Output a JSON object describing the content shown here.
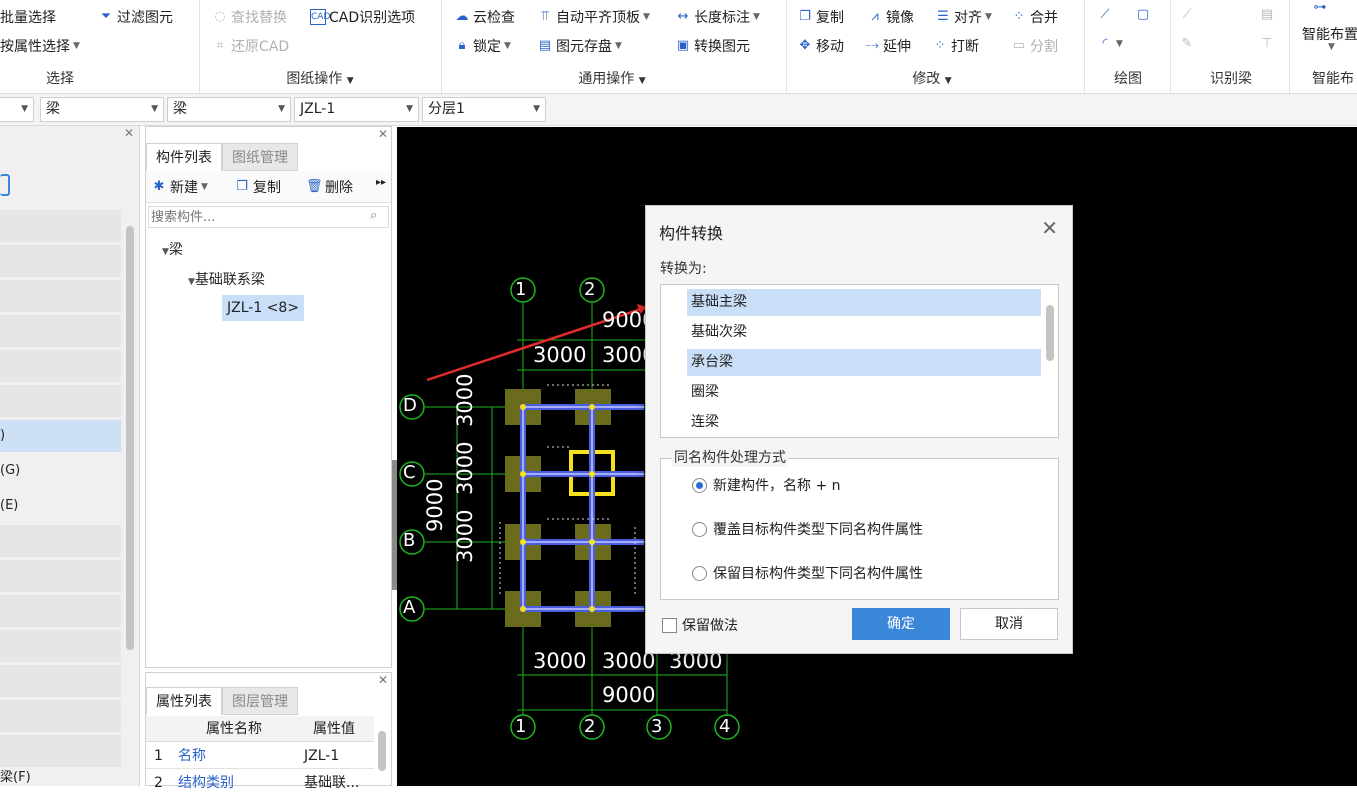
{
  "ribbon": {
    "select": {
      "batch": "批量选择",
      "filter": "过滤图元",
      "by_attr": "按属性选择",
      "label": "选择"
    },
    "drawing_ops": {
      "find_replace": "查找替换",
      "cad_options": "CAD识别选项",
      "restore_cad": "还原CAD",
      "label": "图纸操作"
    },
    "general_ops": {
      "cloud_check": "云检查",
      "auto_align": "自动平齐顶板",
      "length_dim": "长度标注",
      "lock": "锁定",
      "save_elements": "图元存盘",
      "convert": "转换图元",
      "label": "通用操作"
    },
    "modify": {
      "copy": "复制",
      "mirror": "镜像",
      "align": "对齐",
      "merge": "合并",
      "move": "移动",
      "extend": "延伸",
      "break": "打断",
      "split": "分割",
      "label": "修改"
    },
    "draw": {
      "label": "绘图"
    },
    "recognize": {
      "label": "识别梁"
    },
    "smart": {
      "layout": "智能布置",
      "label": "智能布"
    }
  },
  "toolbar": {
    "sel1": "梁",
    "sel2": "梁",
    "sel3": "JZL-1",
    "sel4": "分层1"
  },
  "left_panel": {
    "items": [
      "",
      "(G)",
      "(E)"
    ],
    "bottom": "(F)"
  },
  "component_panel": {
    "tabs": [
      "构件列表",
      "图纸管理"
    ],
    "new": "新建",
    "copy": "复制",
    "delete": "删除",
    "search_placeholder": "搜索构件...",
    "tree": {
      "root": "梁",
      "child": "基础联系梁",
      "leaf": "JZL-1 <8>"
    }
  },
  "property_panel": {
    "tabs": [
      "属性列表",
      "图层管理"
    ],
    "headers": [
      "属性名称",
      "属性值"
    ],
    "rows": [
      {
        "n": "1",
        "name": "名称",
        "value": "JZL-1"
      },
      {
        "n": "2",
        "name": "结构类别",
        "value": "基础联..."
      }
    ]
  },
  "canvas": {
    "axes_top": [
      "1",
      "2"
    ],
    "axes_bottom": [
      "1",
      "2",
      "3",
      "4"
    ],
    "axes_left": [
      "D",
      "C",
      "B",
      "A"
    ],
    "dims_top": [
      "9000",
      "3000",
      "3000"
    ],
    "dims_left": [
      "3000",
      "3000",
      "3000",
      "9000"
    ],
    "dims_bottom": [
      "3000",
      "3000",
      "3000",
      "9000"
    ]
  },
  "dialog": {
    "title": "构件转换",
    "convert_to": "转换为:",
    "options": [
      "基础主梁",
      "基础次梁",
      "承台梁",
      "圈梁",
      "连梁"
    ],
    "group_title": "同名构件处理方式",
    "radios": [
      "新建构件，名称 + n",
      "覆盖目标构件类型下同名构件属性",
      "保留目标构件类型下同名构件属性"
    ],
    "keep_method": "保留做法",
    "ok": "确定",
    "cancel": "取消"
  }
}
